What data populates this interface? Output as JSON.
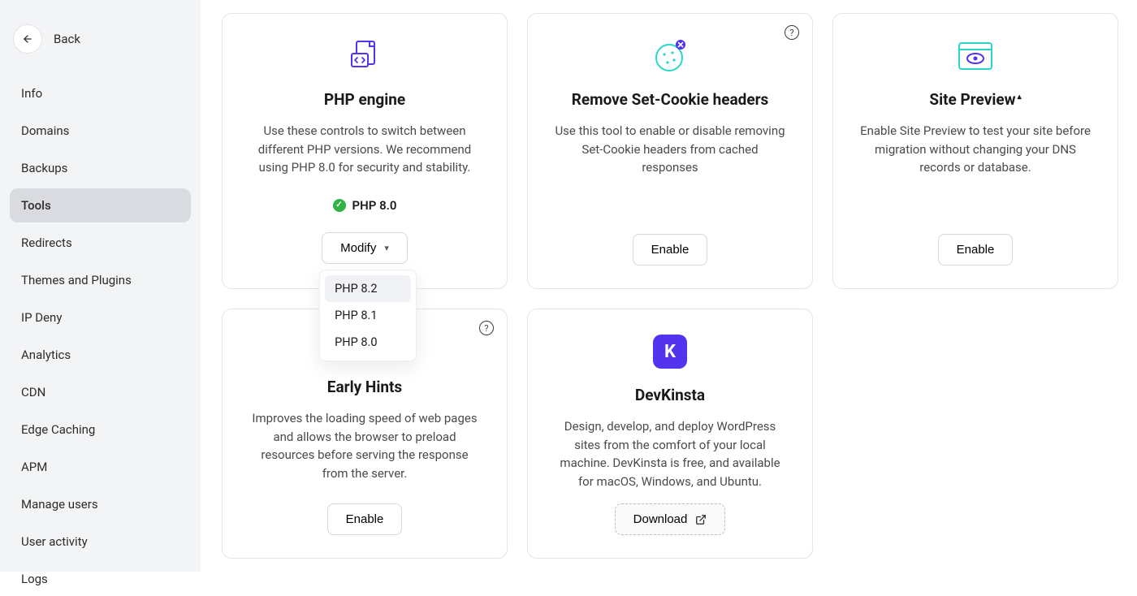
{
  "back": {
    "label": "Back"
  },
  "nav": {
    "items": [
      {
        "label": "Info",
        "active": false
      },
      {
        "label": "Domains",
        "active": false
      },
      {
        "label": "Backups",
        "active": false
      },
      {
        "label": "Tools",
        "active": true
      },
      {
        "label": "Redirects",
        "active": false
      },
      {
        "label": "Themes and Plugins",
        "active": false
      },
      {
        "label": "IP Deny",
        "active": false
      },
      {
        "label": "Analytics",
        "active": false
      },
      {
        "label": "CDN",
        "active": false
      },
      {
        "label": "Edge Caching",
        "active": false
      },
      {
        "label": "APM",
        "active": false
      },
      {
        "label": "Manage users",
        "active": false
      },
      {
        "label": "User activity",
        "active": false
      },
      {
        "label": "Logs",
        "active": false
      }
    ]
  },
  "cards": {
    "php_engine": {
      "title": "PHP engine",
      "desc": "Use these controls to switch between different PHP versions. We recommend using PHP 8.0 for security and stability.",
      "status_label": "PHP 8.0",
      "modify_label": "Modify",
      "options": [
        "PHP 8.2",
        "PHP 8.1",
        "PHP 8.0"
      ]
    },
    "remove_cookie": {
      "title": "Remove Set-Cookie headers",
      "desc": "Use this tool to enable or disable removing Set-Cookie headers from cached responses",
      "button": "Enable"
    },
    "site_preview": {
      "title": "Site Preview",
      "desc": "Enable Site Preview to test your site before migration without changing your DNS records or database.",
      "button": "Enable"
    },
    "early_hints": {
      "title": "Early Hints",
      "desc": "Improves the loading speed of web pages and allows the browser to preload resources before serving the response from the server.",
      "button": "Enable"
    },
    "devkinsta": {
      "title": "DevKinsta",
      "desc": "Design, develop, and deploy WordPress sites from the comfort of your local machine. DevKinsta is free, and available for macOS, Windows, and Ubuntu.",
      "button": "Download"
    }
  },
  "icons": {
    "php_engine": "code-file-icon",
    "remove_cookie": "cookie-remove-icon",
    "site_preview": "preview-eye-icon",
    "early_hints": "lightning-icon",
    "devkinsta": "devkinsta-logo",
    "help": "help-icon",
    "external": "external-link-icon",
    "check": "check-circle-icon",
    "back": "arrow-left-icon",
    "chevron": "chevron-down-icon"
  },
  "colors": {
    "accent_purple": "#5333ed",
    "accent_teal": "#28d7cb",
    "success": "#2fb344",
    "sidebar_bg": "#f3f4f6",
    "active_bg": "#d9dbe0"
  }
}
